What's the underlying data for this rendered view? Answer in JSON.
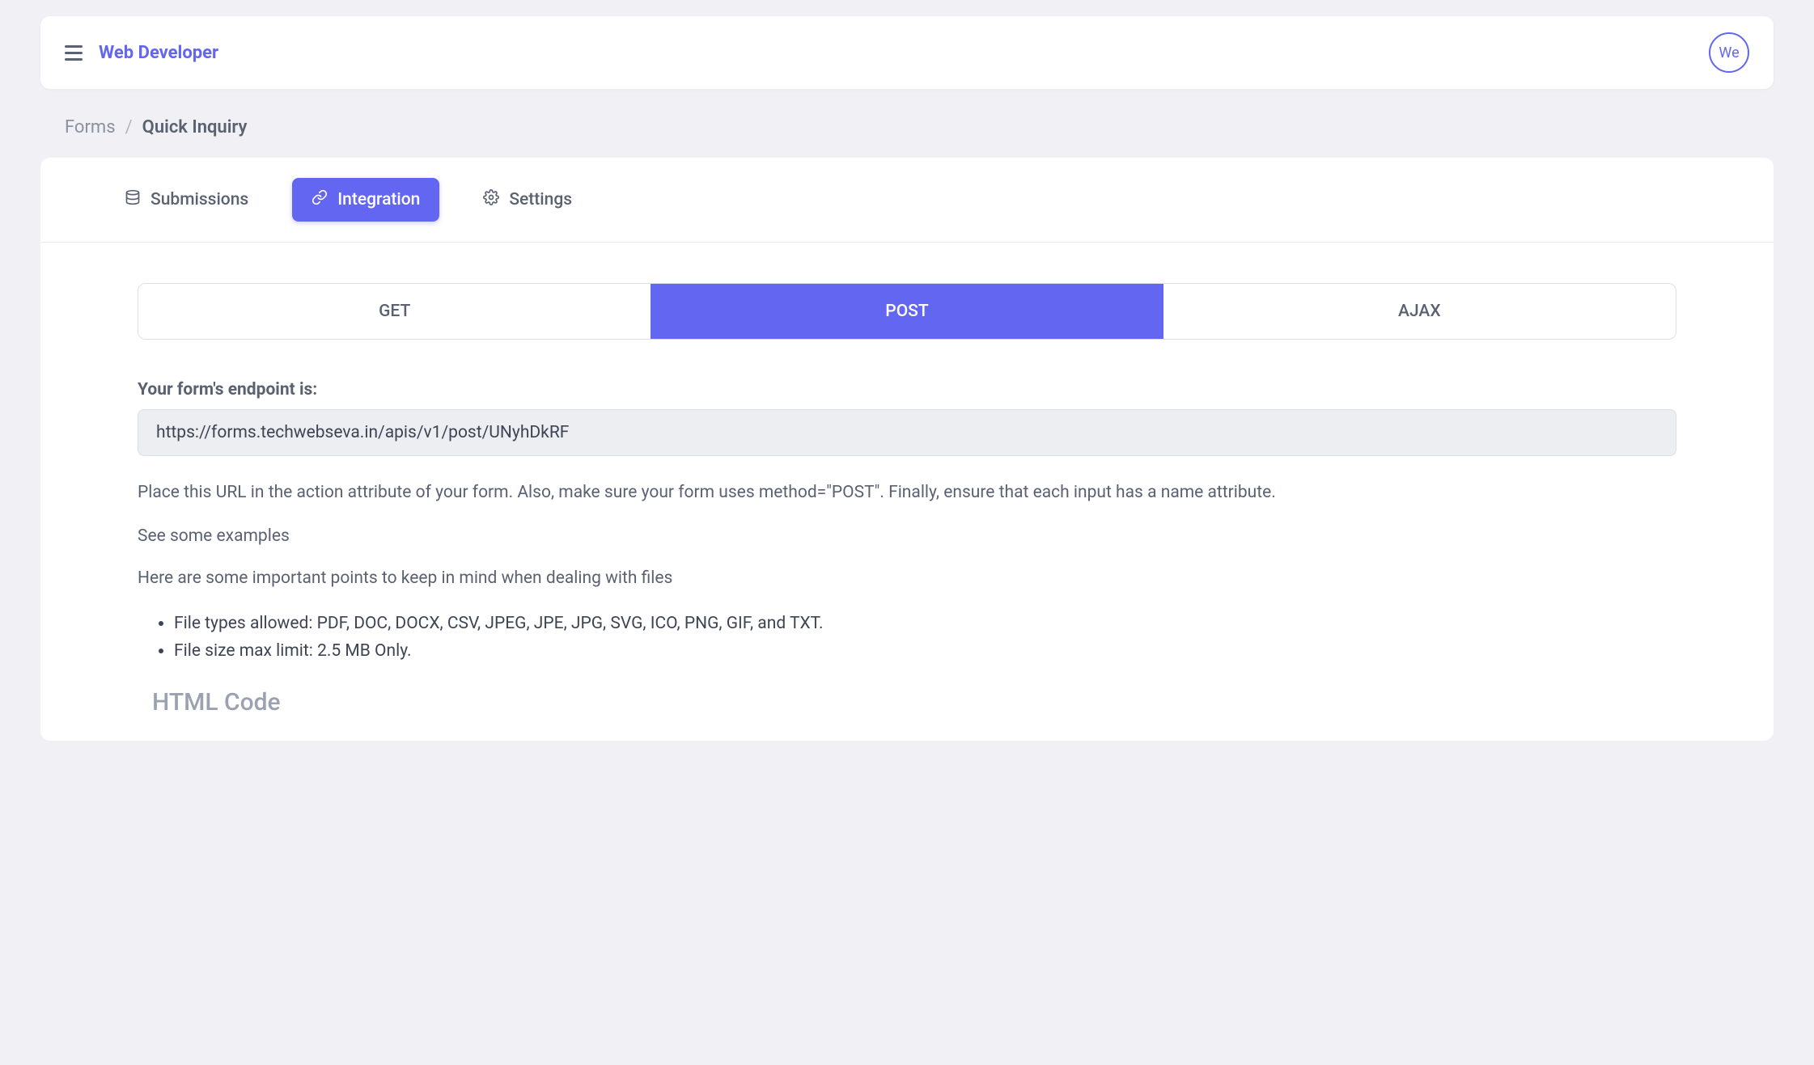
{
  "header": {
    "brand": "Web Developer",
    "avatar_label": "We"
  },
  "breadcrumb": {
    "root": "Forms",
    "separator": "/",
    "current": "Quick Inquiry"
  },
  "tabs": {
    "submissions": "Submissions",
    "integration": "Integration",
    "settings": "Settings"
  },
  "method_tabs": {
    "get": "GET",
    "post": "POST",
    "ajax": "AJAX"
  },
  "endpoint": {
    "label": "Your form's endpoint is:",
    "url": "https://forms.techwebseva.in/apis/v1/post/UNyhDkRF"
  },
  "description": "Place this URL in the action attribute of your form. Also, make sure your form uses method=\"POST\". Finally, ensure that each input has a name attribute.",
  "examples_link": "See some examples",
  "files_intro": "Here are some important points to keep in mind when dealing with files",
  "bullets": {
    "types": "File types allowed: PDF, DOC, DOCX, CSV, JPEG, JPE, JPG, SVG, ICO, PNG, GIF, and TXT.",
    "size": "File size max limit: 2.5 MB Only."
  },
  "html_code_heading": "HTML Code"
}
